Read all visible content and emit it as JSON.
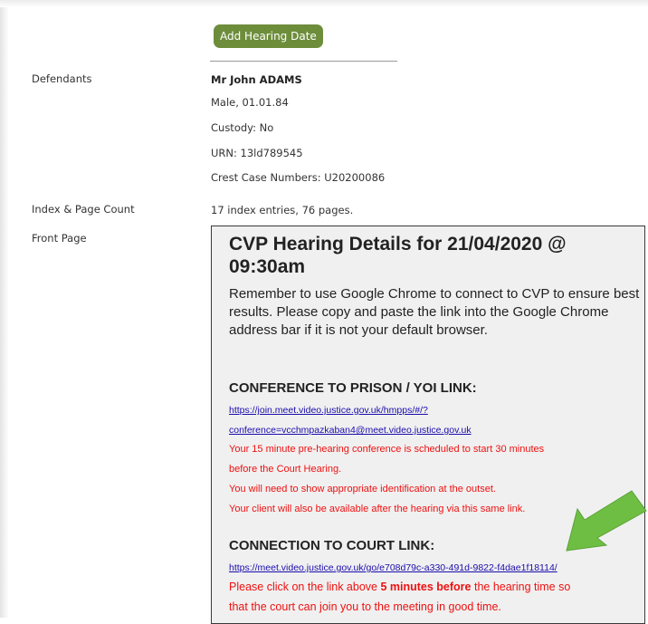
{
  "actions": {
    "add_hearing_date": "Add Hearing Date"
  },
  "defendants": {
    "label": "Defendants",
    "name": "Mr John ADAMS",
    "details": "Male, 01.01.84",
    "custody": "Custody: No",
    "urn": "URN: 13ld789545",
    "crest": "Crest Case Numbers: U20200086"
  },
  "index": {
    "label": "Index & Page Count",
    "value": "17 index entries, 76 pages."
  },
  "front_page": {
    "label": "Front Page",
    "title": "CVP Hearing Details for 21/04/2020 @ 09:30am",
    "intro": "Remember to use Google Chrome to connect to CVP to ensure best results. Please copy and paste the link into the Google Chrome address bar if it is not your default browser.",
    "prison_heading": "CONFERENCE TO PRISON / YOI LINK:",
    "prison_link_line1": "https://join.meet.video.justice.gov.uk/hmpps/#/?",
    "prison_link_line2": "conference=vcchmpazkaban4@meet.video.justice.gov.uk",
    "prison_notes": [
      "Your 15 minute pre-hearing conference is scheduled to start 30 minutes",
      "before the Court Hearing.",
      "You will need to show appropriate identification at the outset.",
      "Your client will also be available after the hearing via this same link."
    ],
    "court_heading": "CONNECTION TO COURT LINK:",
    "court_link": "https://meet.video.justice.gov.uk/go/e708d79c-a330-491d-9822-f4dae1f18114/",
    "court_note_pre": "Please click on the link above ",
    "court_note_bold": "5 minutes before",
    "court_note_post": " the hearing time so",
    "court_note_line2": "that the court can join you to the meeting in good time."
  },
  "colors": {
    "button": "#6d8d3b",
    "arrow": "#6fbe44",
    "link": "#1a0dab",
    "alert": "#ee1111"
  },
  "icons": {
    "arrow": "green-arrow-icon"
  }
}
